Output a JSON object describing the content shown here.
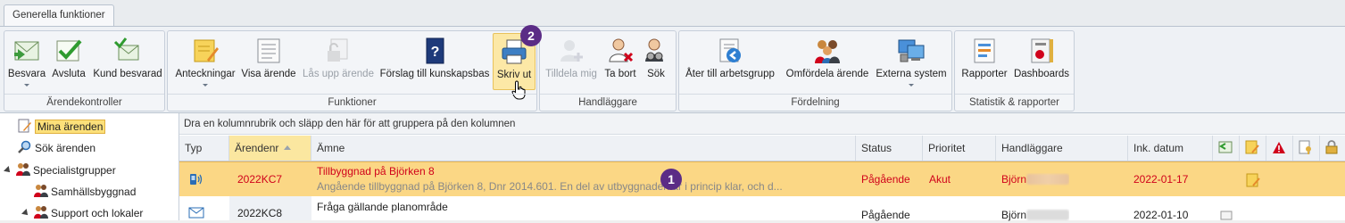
{
  "tabs": [
    "Generella funktioner"
  ],
  "ribbon": {
    "groups": [
      {
        "label": "Ärendekontroller",
        "buttons": [
          "Besvara",
          "Avsluta",
          "Kund besvarad"
        ]
      },
      {
        "label": "Funktioner",
        "buttons": [
          "Anteckningar",
          "Visa ärende",
          "Lås upp ärende",
          "Förslag till kunskapsbas",
          "Skriv ut"
        ]
      },
      {
        "label": "Handläggare",
        "buttons": [
          "Tilldela mig",
          "Ta bort",
          "Sök"
        ]
      },
      {
        "label": "Fördelning",
        "buttons": [
          "Åter till arbetsgrupp",
          "Omfördela ärende",
          "Externa system"
        ]
      },
      {
        "label": "Statistik & rapporter",
        "buttons": [
          "Rapporter",
          "Dashboards"
        ]
      }
    ]
  },
  "badges": [
    "1",
    "2"
  ],
  "tree": {
    "items": [
      "Mina ärenden",
      "Sök ärenden",
      "Specialistgrupper",
      "Samhällsbyggnad",
      "Support och lokaler"
    ]
  },
  "grid": {
    "group_hint": "Dra en kolumnrubrik och släpp den här för att gruppera på den kolumnen",
    "columns": [
      "Typ",
      "Ärendenr",
      "Ämne",
      "Status",
      "Prioritet",
      "Handläggare",
      "Ink. datum"
    ],
    "rows": [
      {
        "id": "2022KC7",
        "subject": "Tillbyggnad på Björken 8",
        "preview": "Angående tillbyggnad på Björken 8, Dnr 2014.601. En del av utbyggnaden är i princip klar, och d...",
        "status": "Pågående",
        "priority": "Akut",
        "handler": "Björn",
        "date": "2022-01-17"
      },
      {
        "id": "2022KC8",
        "subject": "Fråga gällande planområde",
        "preview": "",
        "status": "Pågående",
        "priority": "",
        "handler": "Björn",
        "date": "2022-01-10"
      }
    ]
  },
  "colors": {
    "selected_row": "#fbd785",
    "accent_red": "#d0021b",
    "badge": "#5b2c86",
    "highlight": "#fce8a6"
  }
}
